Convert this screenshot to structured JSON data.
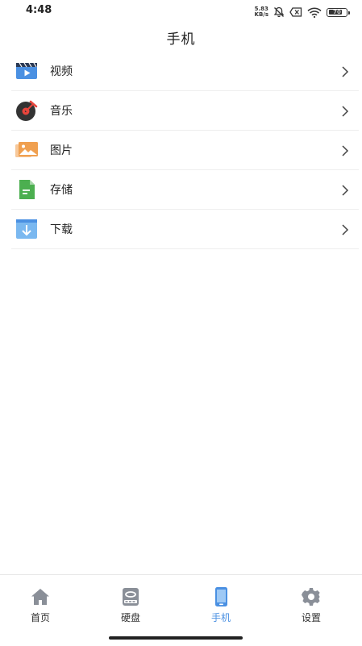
{
  "status_bar": {
    "time": "4:48",
    "net_speed_value": "5.83",
    "net_speed_unit": "KB/s",
    "battery": "70"
  },
  "header": {
    "title": "手机"
  },
  "menu": {
    "items": [
      {
        "label": "视频",
        "icon": "video-icon"
      },
      {
        "label": "音乐",
        "icon": "music-icon"
      },
      {
        "label": "图片",
        "icon": "image-icon"
      },
      {
        "label": "存储",
        "icon": "storage-icon"
      },
      {
        "label": "下载",
        "icon": "download-icon"
      }
    ]
  },
  "bottom_nav": {
    "items": [
      {
        "label": "首页",
        "icon": "home-icon"
      },
      {
        "label": "硬盘",
        "icon": "hard-disk-icon"
      },
      {
        "label": "手机",
        "icon": "phone-icon",
        "active": true
      },
      {
        "label": "设置",
        "icon": "settings-icon"
      }
    ]
  },
  "colors": {
    "accent": "#4a90e2",
    "video": "#4a90e2",
    "music_red": "#e8453c",
    "image": "#f0a050",
    "storage": "#4caf50",
    "download": "#5aa0e8"
  }
}
